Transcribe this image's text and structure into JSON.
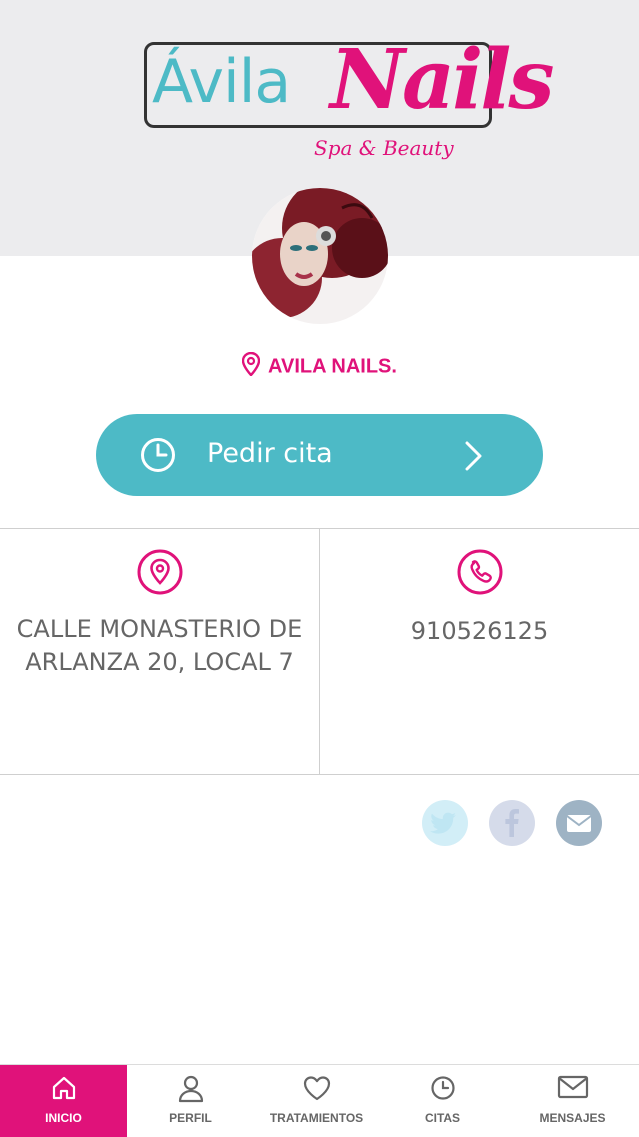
{
  "brand": {
    "logo_word1": "Ávila",
    "logo_word2": "Nails",
    "logo_tagline": "Spa & Beauty",
    "accent": "#e0127a",
    "teal": "#4dbac6"
  },
  "business": {
    "name": "AVILA NAILS."
  },
  "cta": {
    "label": "Pedir cita",
    "icon": "clock-icon"
  },
  "info": {
    "address_line1": "CALLE MONASTERIO DE",
    "address_line2": "ARLANZA 20, LOCAL 7",
    "phone": "910526125"
  },
  "social": [
    "twitter-icon",
    "facebook-icon",
    "mail-icon"
  ],
  "tabs": [
    {
      "label": "INICIO",
      "icon": "home-icon",
      "active": true
    },
    {
      "label": "PERFIL",
      "icon": "user-icon",
      "active": false
    },
    {
      "label": "TRATAMIENTOS",
      "icon": "heart-icon",
      "active": false
    },
    {
      "label": "CITAS",
      "icon": "clock-icon",
      "active": false
    },
    {
      "label": "MENSAJES",
      "icon": "mail-icon",
      "active": false
    }
  ]
}
